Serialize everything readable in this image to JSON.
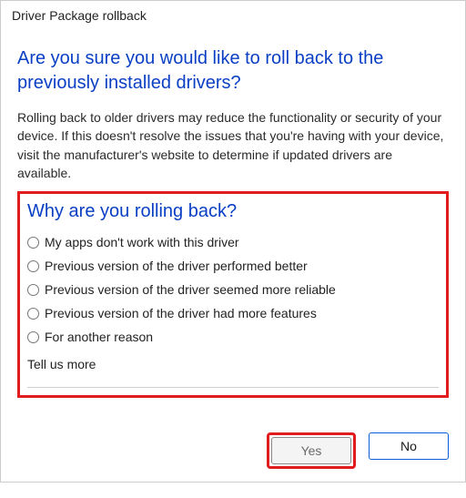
{
  "window": {
    "title": "Driver Package rollback"
  },
  "headline": "Are you sure you would like to roll back to the previously installed drivers?",
  "body": "Rolling back to older drivers may reduce the functionality or security of your device. If this doesn't resolve the issues that you're having with your device, visit the manufacturer's website to determine if updated drivers are available.",
  "subHeadline": "Why are you rolling back?",
  "reasons": [
    "My apps don't work with this driver",
    "Previous version of the driver performed better",
    "Previous version of the driver seemed more reliable",
    "Previous version of the driver had more features",
    "For another reason"
  ],
  "tellMoreLabel": "Tell us more",
  "buttons": {
    "yes": "Yes",
    "no": "No"
  }
}
